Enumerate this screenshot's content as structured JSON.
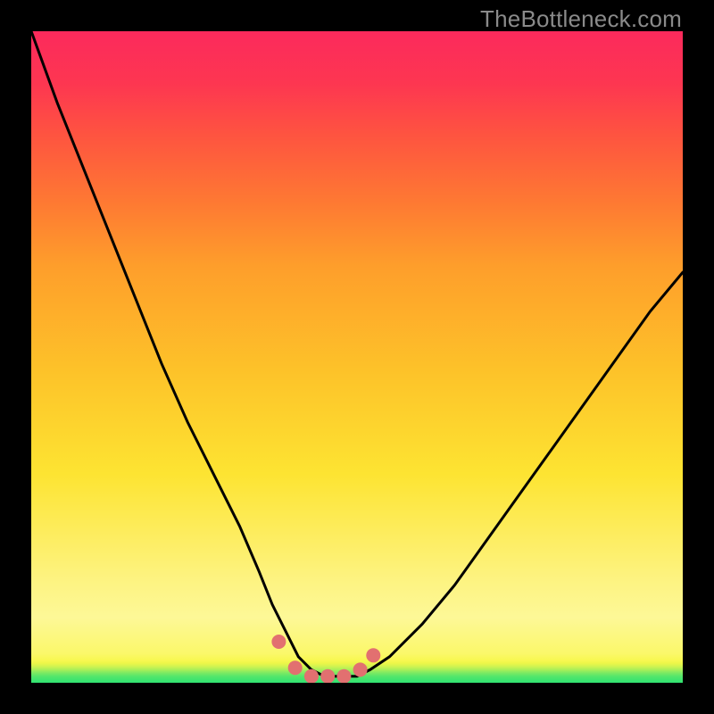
{
  "watermark": "TheBottleneck.com",
  "chart_data": {
    "type": "line",
    "title": "",
    "xlabel": "",
    "ylabel": "",
    "xlim": [
      0,
      100
    ],
    "ylim": [
      0,
      100
    ],
    "grid": false,
    "legend": false,
    "curve_color": "#000000",
    "curve_width": 3,
    "marker_color": "#e27070",
    "marker_radius": 8,
    "x": [
      0,
      4,
      8,
      12,
      16,
      20,
      24,
      28,
      32,
      35,
      37,
      39,
      41,
      43,
      45,
      47,
      50,
      52,
      55,
      60,
      65,
      70,
      75,
      80,
      85,
      90,
      95,
      100
    ],
    "y": [
      100,
      89,
      79,
      69,
      59,
      49,
      40,
      32,
      24,
      17,
      12,
      8,
      4,
      2,
      1,
      1,
      1,
      2,
      4,
      9,
      15,
      22,
      29,
      36,
      43,
      50,
      57,
      63
    ],
    "markers": {
      "x": [
        38,
        40.5,
        43,
        45.5,
        48,
        50.5,
        52.5
      ],
      "y": [
        6.3,
        2.3,
        1.0,
        1.0,
        1.0,
        2.0,
        4.2
      ]
    },
    "background_gradient": {
      "top": "#fc2a5c",
      "upper_mid": "#fe9e2b",
      "mid": "#fdf380",
      "lower": "#edf649",
      "bottom": "#2fe371"
    }
  }
}
